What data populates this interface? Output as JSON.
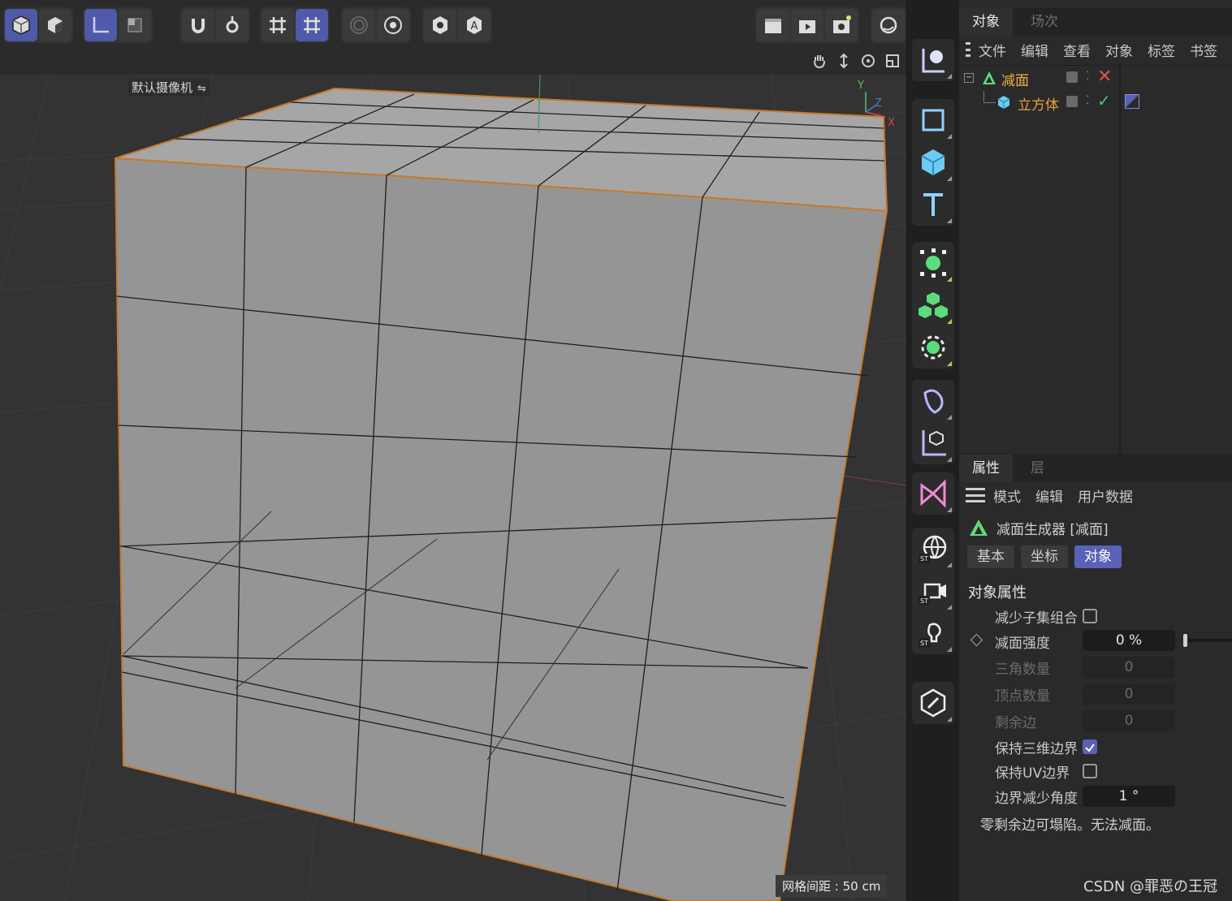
{
  "toolbar": {
    "groups": [
      {
        "name": "view-modes",
        "buttons": [
          "model-mode-icon",
          "polygon-object-mode-icon"
        ]
      },
      {
        "name": "axis",
        "buttons": [
          "world-axis-icon",
          "axis-lock-icon"
        ]
      },
      {
        "name": "snap",
        "buttons": [
          "snap-magnet-icon",
          "snap-settings-icon"
        ]
      },
      {
        "name": "grid",
        "buttons": [
          "grid-icon",
          "grid-snap-icon"
        ]
      },
      {
        "name": "solo",
        "buttons": [
          "solo-off-icon",
          "solo-settings-icon"
        ]
      },
      {
        "name": "visibility",
        "buttons": [
          "view-visibility-icon",
          "auto-icon"
        ]
      },
      {
        "name": "render",
        "buttons": [
          "render-view-icon",
          "render-picture-icon",
          "render-settings-icon"
        ]
      },
      {
        "name": "refresh",
        "buttons": [
          "refresh-icon"
        ]
      }
    ]
  },
  "viewport": {
    "camera_label": "默认摄像机",
    "grid_label": "网格间距 : 50 cm",
    "axis": {
      "y": "Y",
      "z": "Z",
      "x": "X"
    }
  },
  "palette": [
    "object-select-icon",
    "spline-rect-icon",
    "cube-icon",
    "text-icon",
    "generator-icon",
    "cloner-icon",
    "effector-icon",
    "deformer-icon",
    "field-icon",
    "mograph-icon",
    "sky-icon",
    "camera-icon",
    "light-icon",
    "tag-edit-icon"
  ],
  "object_panel": {
    "tabs": [
      "对象",
      "场次"
    ],
    "menu": [
      "文件",
      "编辑",
      "查看",
      "对象",
      "标签",
      "书签"
    ],
    "tree": [
      {
        "name": "减面",
        "color": "#e9b63f",
        "status": "disabled"
      },
      {
        "name": "立方体",
        "color": "#e8a23a",
        "status": "enabled"
      }
    ]
  },
  "attr_panel": {
    "tabs": [
      "属性",
      "层"
    ],
    "menu": [
      "模式",
      "编辑",
      "用户数据"
    ],
    "object_title": "减面生成器 [减面]",
    "subtabs": [
      "基本",
      "坐标",
      "对象"
    ],
    "active_subtab": 2,
    "section_title": "对象属性",
    "props": {
      "reduce_children": {
        "label": "减少子集组合",
        "checked": false
      },
      "strength": {
        "label": "减面强度",
        "value": "0 %"
      },
      "triangles": {
        "label": "三角数量",
        "value": "0"
      },
      "vertices": {
        "label": "顶点数量",
        "value": "0"
      },
      "remaining_edges": {
        "label": "剩余边",
        "value": "0"
      },
      "keep_3d_boundary": {
        "label": "保持三维边界",
        "checked": true
      },
      "keep_uv_boundary": {
        "label": "保持UV边界",
        "checked": false
      },
      "boundary_angle": {
        "label": "边界减少角度",
        "value": "1 °"
      }
    },
    "note": "零剩余边可塌陷。无法减面。"
  },
  "watermark": "CSDN @罪恶の王冠",
  "colors": {
    "accent": "#5961b8",
    "mesh_edge": "#c67a2a",
    "face_top": "#a6a6a6",
    "face_front": "#9a9a9a"
  }
}
